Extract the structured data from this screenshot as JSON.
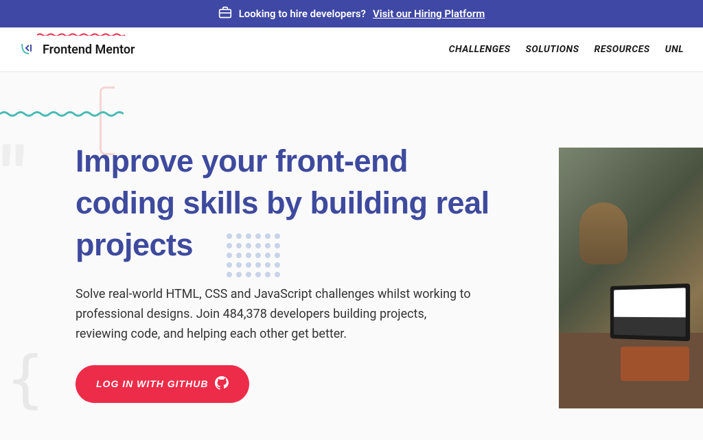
{
  "banner": {
    "text": "Looking to hire developers?",
    "link_text": "Visit our Hiring Platform"
  },
  "logo": {
    "name": "Frontend Mentor"
  },
  "nav": {
    "items": [
      "CHALLENGES",
      "SOLUTIONS",
      "RESOURCES",
      "UNL"
    ]
  },
  "hero": {
    "title": "Improve your front-end coding skills by building real projects",
    "subtitle": "Solve real-world HTML, CSS and JavaScript challenges whilst working to professional designs. Join 484,378 developers building projects, reviewing code, and helping each other get better.",
    "cta_label": "LOG IN WITH GITHUB"
  }
}
